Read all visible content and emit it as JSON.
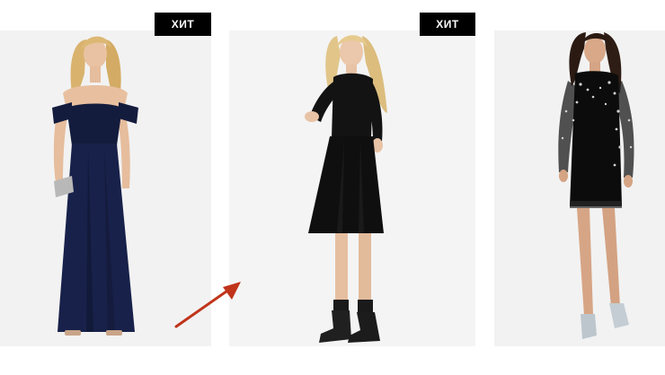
{
  "products": [
    {
      "badge": "ХИТ",
      "has_badge": true,
      "dress_color": "#141c3d"
    },
    {
      "badge": "ХИТ",
      "has_badge": true,
      "dress_color": "#111111"
    },
    {
      "badge": "",
      "has_badge": false,
      "dress_color": "#0c0c0c"
    }
  ],
  "annotation": {
    "arrow_color": "#c0341a"
  },
  "colors": {
    "card_background": "#f2f2f2",
    "badge_background": "#000000",
    "badge_text": "#ffffff",
    "page_background": "#ffffff"
  }
}
